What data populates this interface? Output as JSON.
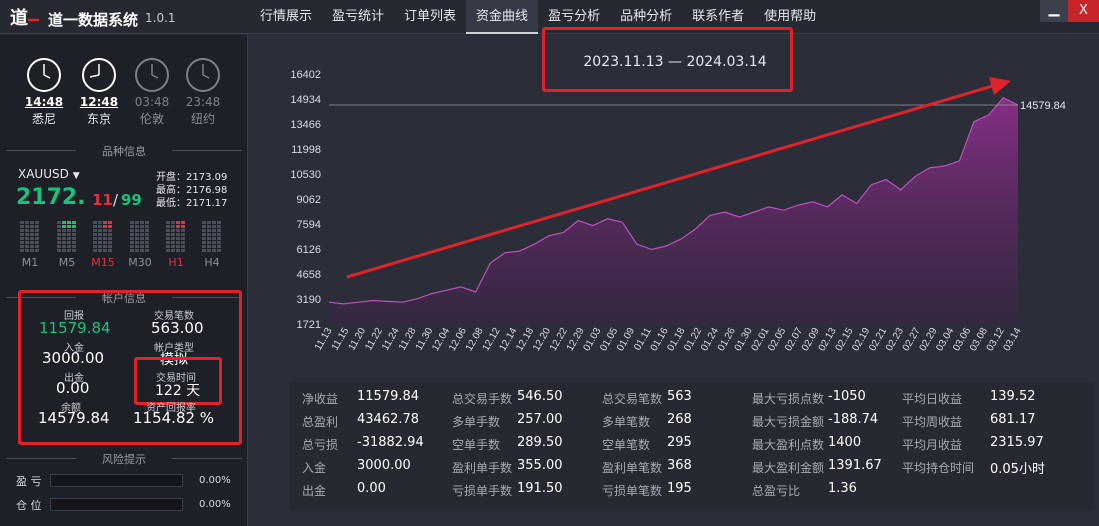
{
  "app": {
    "title": "道一数据系统",
    "version": "1.0.1"
  },
  "nav": [
    "行情展示",
    "盈亏统计",
    "订单列表",
    "资金曲线",
    "盈亏分析",
    "品种分析",
    "联系作者",
    "使用帮助"
  ],
  "nav_active": 3,
  "window": {
    "min": "▁",
    "close": "X"
  },
  "clocks": [
    {
      "time": "14:48",
      "city": "悉尼",
      "active": true
    },
    {
      "time": "12:48",
      "city": "东京",
      "active": true
    },
    {
      "time": "03:48",
      "city": "伦敦",
      "active": false
    },
    {
      "time": "23:48",
      "city": "纽约",
      "active": false
    }
  ],
  "symbol_panel": {
    "header": "品种信息",
    "symbol": "XAUUSD",
    "price_main": "2172.",
    "price_red": "11",
    "price_sep": "/",
    "price_green": "99",
    "open_label": "开盘：",
    "open": "2173.09",
    "high_label": "最高：",
    "high": "2176.98",
    "low_label": "最低：",
    "low": "2171.17",
    "timeframes": [
      "M1",
      "M5",
      "M15",
      "M30",
      "H1",
      "H4"
    ]
  },
  "account": {
    "header": "帐户信息",
    "return_label": "回报",
    "return_value": "11579.84",
    "trades_label": "交易笔数",
    "trades_value": "563.00",
    "deposit_label": "入金",
    "deposit_value": "3000.00",
    "acct_type_label": "帐户类型",
    "acct_type_value": "模拟",
    "withdraw_label": "出金",
    "withdraw_value": "0.00",
    "time_label": "交易时间",
    "time_value": "122 天",
    "balance_label": "余额",
    "balance_value": "14579.84",
    "yield_label": "资产回报率",
    "yield_value": "1154.82 %"
  },
  "risk": {
    "header": "风险提示",
    "rows": [
      {
        "label": "盈 亏",
        "value": "0.00%"
      },
      {
        "label": "仓 位",
        "value": "0.00%"
      }
    ]
  },
  "chart_data": {
    "type": "area",
    "title": "2023.11.13 — 2024.03.14",
    "y_ticks": [
      1721,
      3190,
      4658,
      6126,
      7594,
      9062,
      10530,
      11998,
      13466,
      14934,
      16402
    ],
    "ylim": [
      1721,
      16402
    ],
    "last_value": "14579.84",
    "x_labels": [
      "11.13",
      "11.15",
      "11.20",
      "11.22",
      "11.24",
      "11.28",
      "11.30",
      "12.04",
      "12.06",
      "12.08",
      "12.12",
      "12.14",
      "12.18",
      "12.20",
      "12.22",
      "12.29",
      "01.03",
      "01.05",
      "01.09",
      "01.11",
      "01.16",
      "01.18",
      "01.22",
      "01.24",
      "01.26",
      "01.30",
      "02.01",
      "02.05",
      "02.07",
      "02.09",
      "02.13",
      "02.15",
      "02.19",
      "02.21",
      "02.23",
      "02.27",
      "02.29",
      "03.04",
      "03.06",
      "03.08",
      "03.12",
      "03.14"
    ],
    "values": [
      3000,
      2900,
      3000,
      3100,
      3050,
      3000,
      3200,
      3500,
      3700,
      3900,
      3600,
      5300,
      5900,
      6000,
      6400,
      6900,
      7100,
      7800,
      7500,
      7900,
      7700,
      6400,
      6100,
      6300,
      6700,
      7300,
      8100,
      8300,
      8000,
      8300,
      8600,
      8400,
      8700,
      8900,
      8600,
      9300,
      8800,
      9900,
      10200,
      9600,
      10400,
      10900,
      11000,
      11300,
      13600,
      14000,
      15000,
      14579.84
    ],
    "color": "#7a2a7a"
  },
  "stats": [
    [
      {
        "label": "净收益",
        "value": "11579.84"
      },
      {
        "label": "总盈利",
        "value": "43462.78"
      },
      {
        "label": "总亏损",
        "value": "-31882.94"
      },
      {
        "label": "入金",
        "value": "3000.00"
      },
      {
        "label": "出金",
        "value": "0.00"
      }
    ],
    [
      {
        "label": "总交易手数",
        "value": "546.50"
      },
      {
        "label": "多单手数",
        "value": "257.00"
      },
      {
        "label": "空单手数",
        "value": "289.50"
      },
      {
        "label": "盈利单手数",
        "value": "355.00"
      },
      {
        "label": "亏损单手数",
        "value": "191.50"
      }
    ],
    [
      {
        "label": "总交易笔数",
        "value": "563"
      },
      {
        "label": "多单笔数",
        "value": "268"
      },
      {
        "label": "空单笔数",
        "value": "295"
      },
      {
        "label": "盈利单笔数",
        "value": "368"
      },
      {
        "label": "亏损单笔数",
        "value": "195"
      }
    ],
    [
      {
        "label": "最大亏损点数",
        "value": "-1050"
      },
      {
        "label": "最大亏损金额",
        "value": "-188.74"
      },
      {
        "label": "最大盈利点数",
        "value": "1400"
      },
      {
        "label": "最大盈利金额",
        "value": "1391.67"
      },
      {
        "label": "总盈亏比",
        "value": "1.36"
      }
    ],
    [
      {
        "label": "平均日收益",
        "value": "139.52"
      },
      {
        "label": "平均周收益",
        "value": "681.17"
      },
      {
        "label": "平均月收益",
        "value": "2315.97"
      },
      {
        "label": "平均持仓时间",
        "value": "0.05小时"
      }
    ]
  ]
}
